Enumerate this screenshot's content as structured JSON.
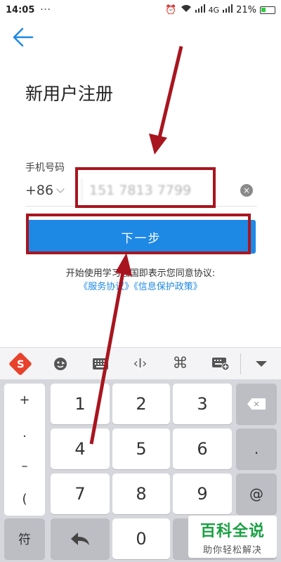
{
  "status": {
    "time": "14:05",
    "dots": "···",
    "network": "4G",
    "battery": "21%"
  },
  "page": {
    "title": "新用户注册",
    "phone_label": "手机号码",
    "country_code": "+86",
    "phone_value": "151 7813 7799",
    "clear_icon": "×",
    "next_label": "下一步",
    "agreement_text": "开始使用学习强国即表示您同意协议:",
    "link_service": "《服务协议》",
    "link_privacy": "《信息保护政策》"
  },
  "toolbar": {
    "cursor_icon": "‹I›",
    "cmd_icon": "⌘"
  },
  "keyboard": {
    "symbols": [
      "+",
      ".",
      "–",
      "("
    ],
    "keys": [
      "1",
      "2",
      "3",
      "4",
      "5",
      "6",
      "7",
      "8",
      "9",
      "0"
    ],
    "dot": ".",
    "at": "@",
    "symbol_key": "符"
  },
  "watermark": {
    "title": "百科全说",
    "subtitle": "助你轻松解决"
  }
}
